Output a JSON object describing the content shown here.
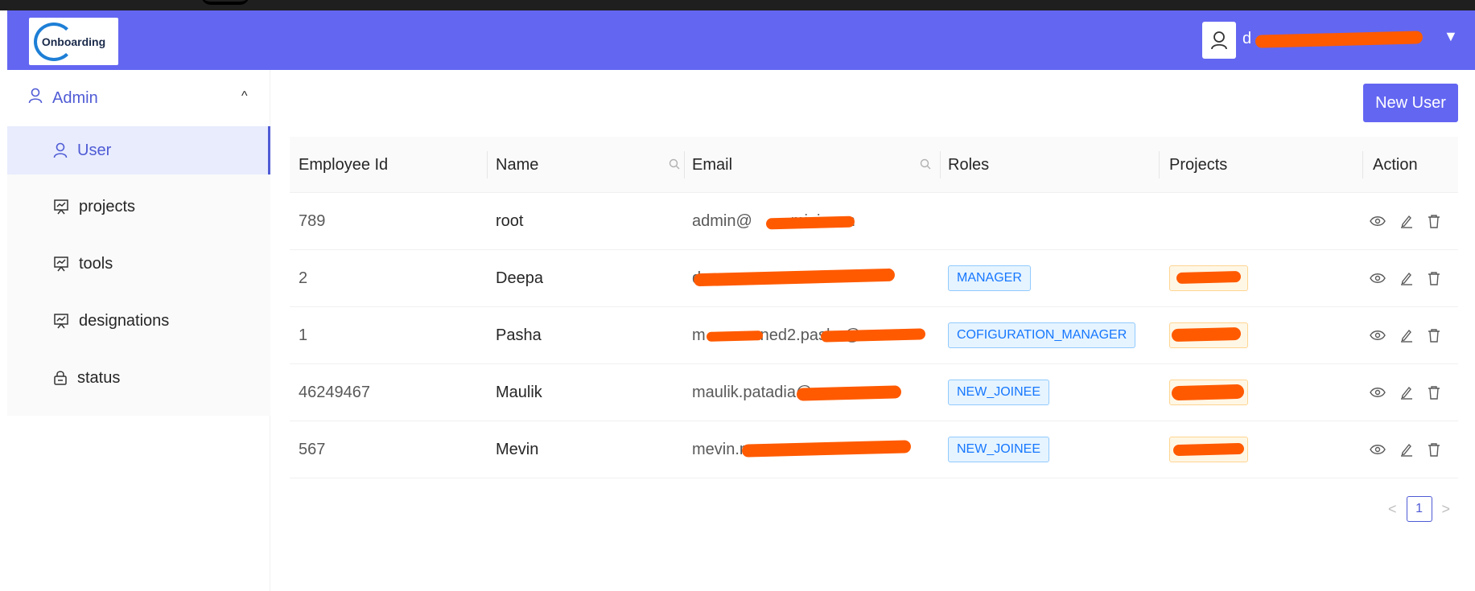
{
  "header": {
    "logo_text": "Onboarding",
    "user_name": "d",
    "caret": "▼",
    "bg_color": "#6366f1"
  },
  "sidebar": {
    "group_label": "Admin",
    "group_caret": "^",
    "items": [
      {
        "label": "User",
        "icon": "user-icon"
      },
      {
        "label": "projects",
        "icon": "presentation-icon"
      },
      {
        "label": "tools",
        "icon": "presentation-icon"
      },
      {
        "label": "designations",
        "icon": "presentation-icon"
      },
      {
        "label": "status",
        "icon": "lock-icon"
      }
    ]
  },
  "toolbar": {
    "new_user_label": "New User"
  },
  "table": {
    "columns": [
      "Employee Id",
      "Name",
      "Email",
      "Roles",
      "Projects",
      "Action"
    ],
    "rows": [
      {
        "employee_id": "789",
        "name": "root",
        "email": "admin@",
        "email_tail": "mini.com",
        "role": ""
      },
      {
        "employee_id": "2",
        "name": "Deepa",
        "email": "d",
        "email_tail": "",
        "role": "MANAGER"
      },
      {
        "employee_id": "1",
        "name": "Pasha",
        "email": "m",
        "email_tail": "ned2.pasha@",
        "role": "COFIGURATION_MANAGER"
      },
      {
        "employee_id": "46249467",
        "name": "Maulik",
        "email": "maulik.patadia@",
        "email_tail": "",
        "role": "NEW_JOINEE"
      },
      {
        "employee_id": "567",
        "name": "Mevin",
        "email": "mevin.m",
        "email_tail": "",
        "role": "NEW_JOINEE"
      }
    ]
  },
  "pagination": {
    "prev": "<",
    "current": "1",
    "next": ">"
  },
  "colors": {
    "accent": "#6366f1",
    "redaction": "#ff5a00",
    "tag_blue": "#1677ff",
    "tag_orange_border": "#ffd591"
  }
}
